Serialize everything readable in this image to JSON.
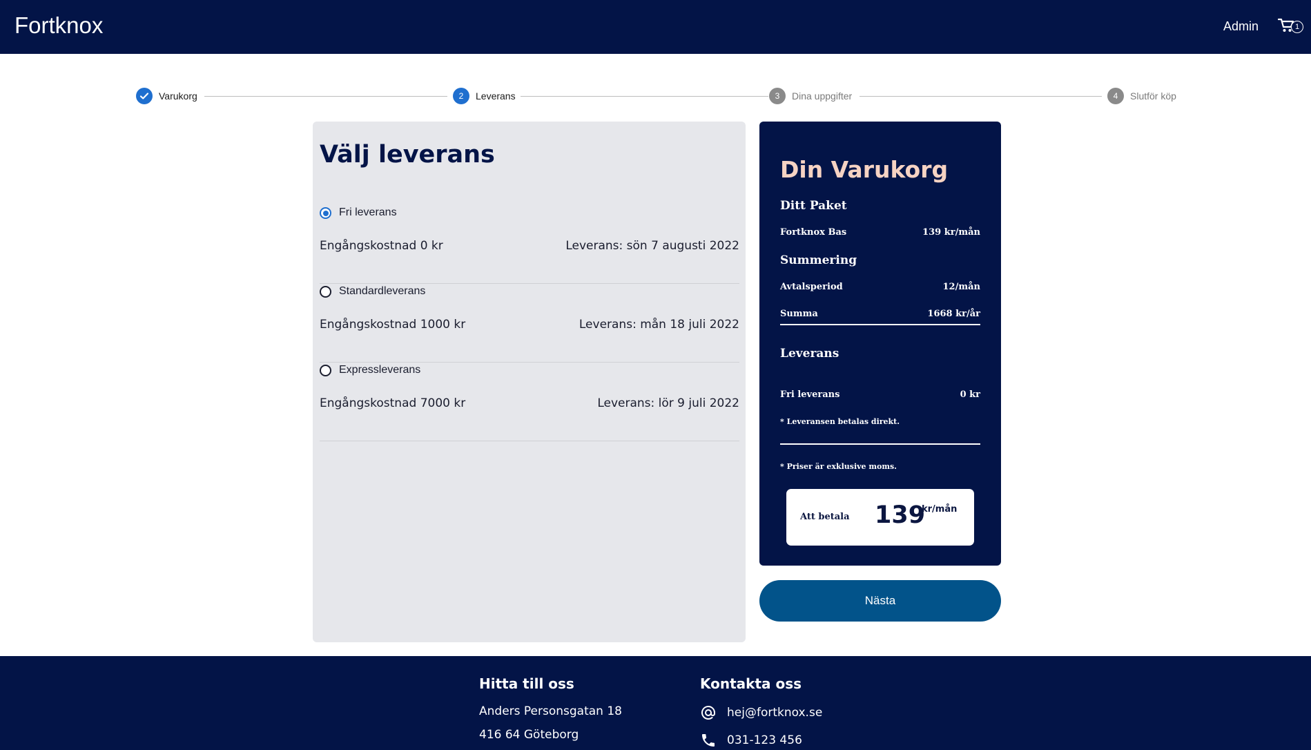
{
  "header": {
    "brand": "Fortknox",
    "admin_label": "Admin",
    "cart_count": "1"
  },
  "stepper": {
    "steps": [
      {
        "number": "1",
        "label": "Varukorg",
        "state": "done"
      },
      {
        "number": "2",
        "label": "Leverans",
        "state": "active"
      },
      {
        "number": "3",
        "label": "Dina uppgifter",
        "state": "todo"
      },
      {
        "number": "4",
        "label": "Slutför köp",
        "state": "todo"
      }
    ]
  },
  "delivery": {
    "title": "Välj leverans",
    "selected": "Fri leverans",
    "options": [
      {
        "name": "Fri leverans",
        "cost": "Engångskostnad 0 kr",
        "date": "Leverans: sön 7 augusti 2022"
      },
      {
        "name": "Standardleverans",
        "cost": "Engångskostnad 1000 kr",
        "date": "Leverans: mån 18 juli 2022"
      },
      {
        "name": "Expressleverans",
        "cost": "Engångskostnad 7000 kr",
        "date": "Leverans: lör 9 juli 2022"
      }
    ]
  },
  "summary": {
    "title": "Din Varukorg",
    "package_heading": "Ditt Paket",
    "package_name": "Fortknox Bas",
    "package_price": "139 kr/mån",
    "sum_heading": "Summering",
    "period_label": "Avtalsperiod",
    "period_value": "12/mån",
    "sum_label": "Summa",
    "sum_value": "1668 kr/år",
    "delivery_heading": "Leverans",
    "delivery_name": "Fri leverans",
    "delivery_price": "0 kr",
    "delivery_note": "* Leveransen betalas direkt.",
    "vat_note": "* Priser är exklusive moms.",
    "pay_label": "Att betala",
    "pay_amount": "139",
    "pay_unit": "kr/mån"
  },
  "next_label": "Nästa",
  "footer": {
    "find_title": "Hitta till oss",
    "address_line1": "Anders Personsgatan 18",
    "address_line2": "416 64 Göteborg",
    "contact_title": "Kontakta oss",
    "email": "hej@fortknox.se",
    "phone": "031-123 456"
  },
  "colors": {
    "navy": "#031447",
    "accent_blue": "#1f6fcf",
    "button_blue": "#02538a",
    "summary_title": "#f6d3c3",
    "panel_gray": "#e6e7eb"
  }
}
